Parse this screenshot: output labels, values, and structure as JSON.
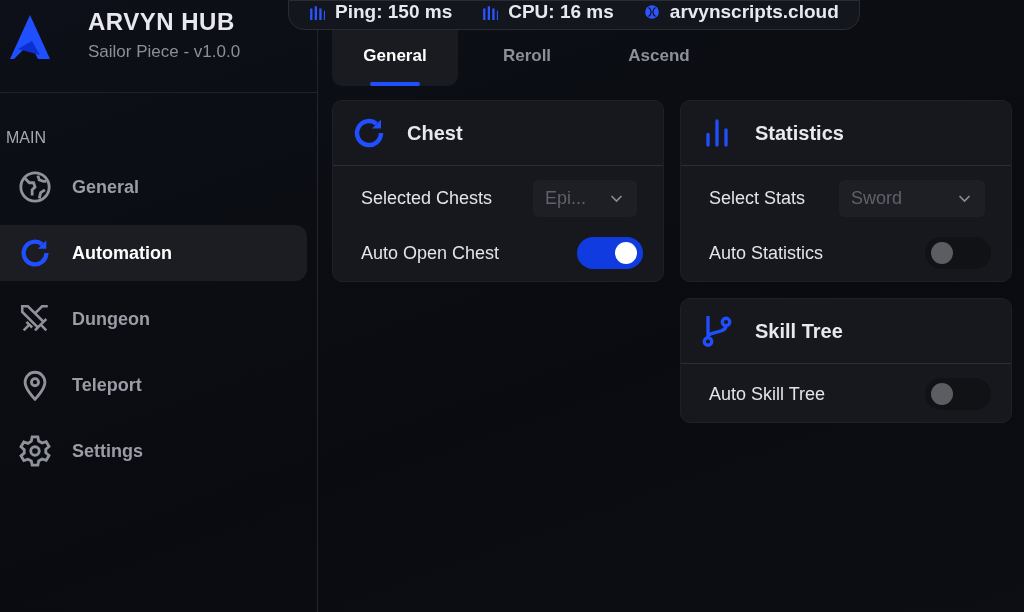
{
  "app": {
    "title": "ARVYN HUB",
    "subtitle": "Sailor Piece - v1.0.0"
  },
  "status_pill": [
    {
      "kind": "bars",
      "text": "Ping: 150 ms"
    },
    {
      "kind": "bars",
      "text": "CPU: 16 ms"
    },
    {
      "kind": "globe",
      "text": "arvynscripts.cloud"
    }
  ],
  "tabs": [
    {
      "label": "General",
      "selected": true
    },
    {
      "label": "Reroll",
      "selected": false
    },
    {
      "label": "Ascend",
      "selected": false
    }
  ],
  "sidebar": {
    "section": "MAIN",
    "items": [
      {
        "label": "General",
        "selected": false
      },
      {
        "label": "Automation",
        "selected": true
      },
      {
        "label": "Dungeon",
        "selected": false
      },
      {
        "label": "Teleport",
        "selected": false
      },
      {
        "label": "Settings",
        "selected": false
      }
    ]
  },
  "columns": [
    [
      {
        "title": "Chest",
        "rows": [
          {
            "kind": "dropdown",
            "label": "Selected Chests",
            "value": "Epi..."
          },
          {
            "kind": "toggle",
            "label": "Auto Open Chest",
            "on": true
          }
        ]
      }
    ],
    [
      {
        "title": "Statistics",
        "rows": [
          {
            "kind": "dropdown",
            "label": "Select Stats",
            "value": "Sword"
          },
          {
            "kind": "toggle",
            "label": "Auto Statistics",
            "on": false
          }
        ]
      },
      {
        "title": "Skill Tree",
        "rows": [
          {
            "kind": "toggle",
            "label": "Auto Skill Tree",
            "on": false
          }
        ]
      }
    ]
  ]
}
